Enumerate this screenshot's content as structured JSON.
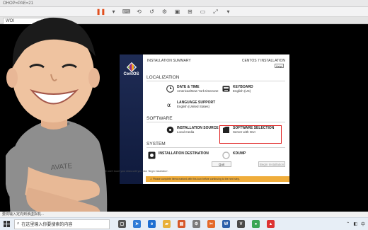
{
  "window": {
    "title": "OHOP=PAE=21"
  },
  "tab": {
    "label": "WOI",
    "close": "×"
  },
  "installer": {
    "header_left": "INSTALLATION SUMMARY",
    "header_right": "CENTOS 7 INSTALLATION",
    "keyboard_badge": "Help!",
    "brand": "CentOS",
    "sections": {
      "localization": "LOCALIZATION",
      "software": "SOFTWARE",
      "system": "SYSTEM"
    },
    "items": {
      "date_time": {
        "name": "DATE & TIME",
        "sub": "Americas/New York timezone"
      },
      "keyboard": {
        "name": "KEYBOARD",
        "sub": "English (US)"
      },
      "language": {
        "name": "LANGUAGE SUPPORT",
        "sub": "English (United States)"
      },
      "source": {
        "name": "INSTALLATION SOURCE",
        "sub": "Local media"
      },
      "software_selection": {
        "name": "SOFTWARE SELECTION",
        "sub": "Server with GUI"
      },
      "destination": {
        "name": "INSTALLATION DESTINATION",
        "sub": ""
      },
      "kdump": {
        "name": "KDUMP",
        "sub": ""
      }
    },
    "buttons": {
      "quit": "Quit",
      "begin": "Begin Installation"
    },
    "note": "We won't touch your disks until you click 'Begin Installation'.",
    "warning": "Please complete items marked with this icon before continuing to the next step."
  },
  "status_text": "要将输入定向到该虚拟机...",
  "taskbar": {
    "search_placeholder": "在这里输入你要搜索的内容",
    "tray_text": "中"
  },
  "colors": {
    "accent_red": "#e01b1b",
    "warning": "#f0ad3b",
    "sidebar": "#1f2c55"
  }
}
